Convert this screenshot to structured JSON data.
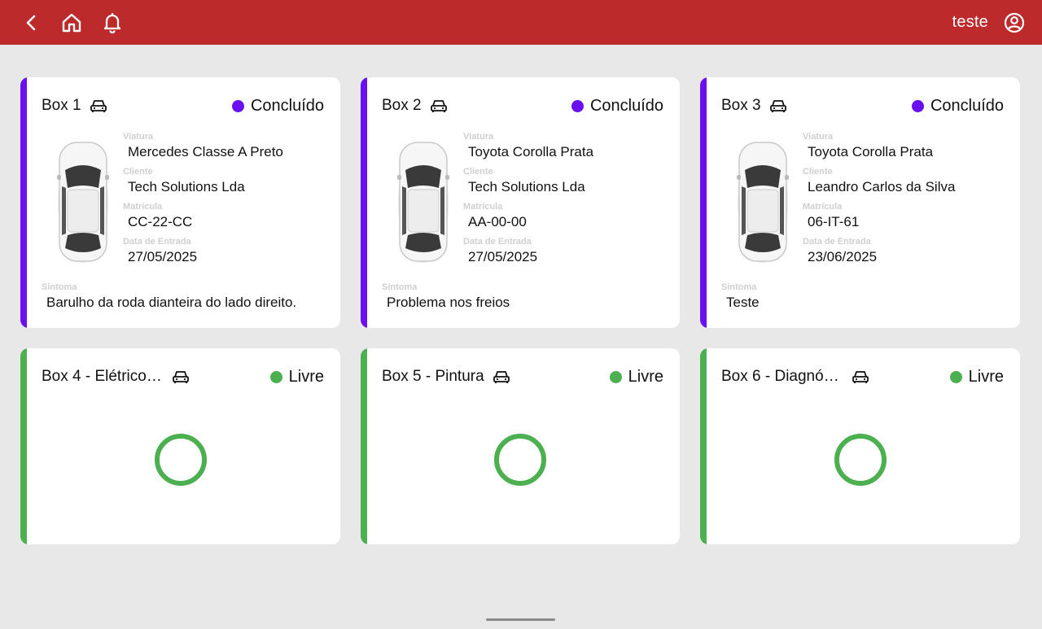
{
  "header": {
    "username": "teste",
    "icons": [
      "back-icon",
      "home-icon",
      "bell-icon",
      "user-account-icon"
    ]
  },
  "colors": {
    "header_bg": "#bc2a2b",
    "concluido": "#6a0ff0",
    "livre": "#4caf50",
    "background": "#e8e8e8"
  },
  "labels": {
    "viatura": "Viatura",
    "cliente": "Cliente",
    "matricula": "Matrícula",
    "data_entrada": "Data de Entrada",
    "sintoma": "Sintoma"
  },
  "boxes": [
    {
      "title": "Box 1",
      "status": "Concluído",
      "viatura": "Mercedes Classe A Preto",
      "cliente": "Tech Solutions Lda",
      "matricula": "CC-22-CC",
      "data_entrada": "27/05/2025",
      "sintoma": "Barulho da roda dianteira do lado direito."
    },
    {
      "title": "Box 2",
      "status": "Concluído",
      "viatura": "Toyota Corolla Prata",
      "cliente": "Tech Solutions Lda",
      "matricula": "AA-00-00",
      "data_entrada": "27/05/2025",
      "sintoma": "Problema nos freios"
    },
    {
      "title": "Box 3",
      "status": "Concluído",
      "viatura": "Toyota Corolla Prata",
      "cliente": "Leandro Carlos da Silva",
      "matricula": "06-IT-61",
      "data_entrada": "23/06/2025",
      "sintoma": "Teste"
    },
    {
      "title": "Box 4 - Elétrico …",
      "status": "Livre"
    },
    {
      "title": "Box 5 - Pintura",
      "status": "Livre"
    },
    {
      "title": "Box 6 - Diagnóst…",
      "status": "Livre"
    }
  ]
}
